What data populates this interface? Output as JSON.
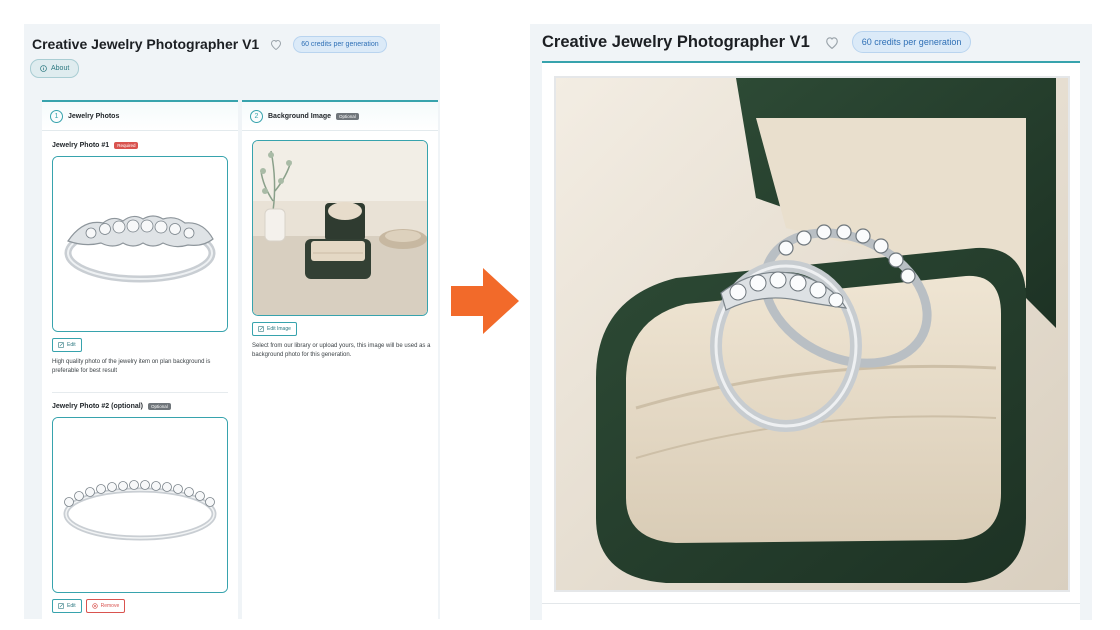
{
  "app": {
    "title": "Creative Jewelry Photographer V1",
    "credits": "60 credits per generation",
    "about_label": "About"
  },
  "form": {
    "section1": {
      "number": "1",
      "title": "Jewelry Photos",
      "photo1_label": "Jewelry Photo #1",
      "photo1_tag": "Required",
      "photo1_edit": "Edit",
      "photo1_help": "High quality photo of the jewelry item on plan background is preferable for best result",
      "photo2_label": "Jewelry Photo #2 (optional)",
      "photo2_tag": "Optional",
      "photo2_edit": "Edit",
      "photo2_remove": "Remove"
    },
    "section2": {
      "number": "2",
      "title": "Background Image",
      "tag": "Optional",
      "edit_image": "Edit Image",
      "help": "Select from our library or upload yours, this image will be used as a background photo for this generation."
    }
  },
  "result": {
    "title": "Creative Jewelry Photographer V1",
    "credits": "60 credits per generation"
  },
  "colors": {
    "accent": "#37a3ad",
    "arrow": "#f26a2a",
    "required": "#d9534f",
    "badge_bg": "#dbeaf8"
  },
  "icons": [
    "heart-icon",
    "info-icon",
    "edit-icon",
    "remove-icon",
    "arrow-right-icon"
  ]
}
